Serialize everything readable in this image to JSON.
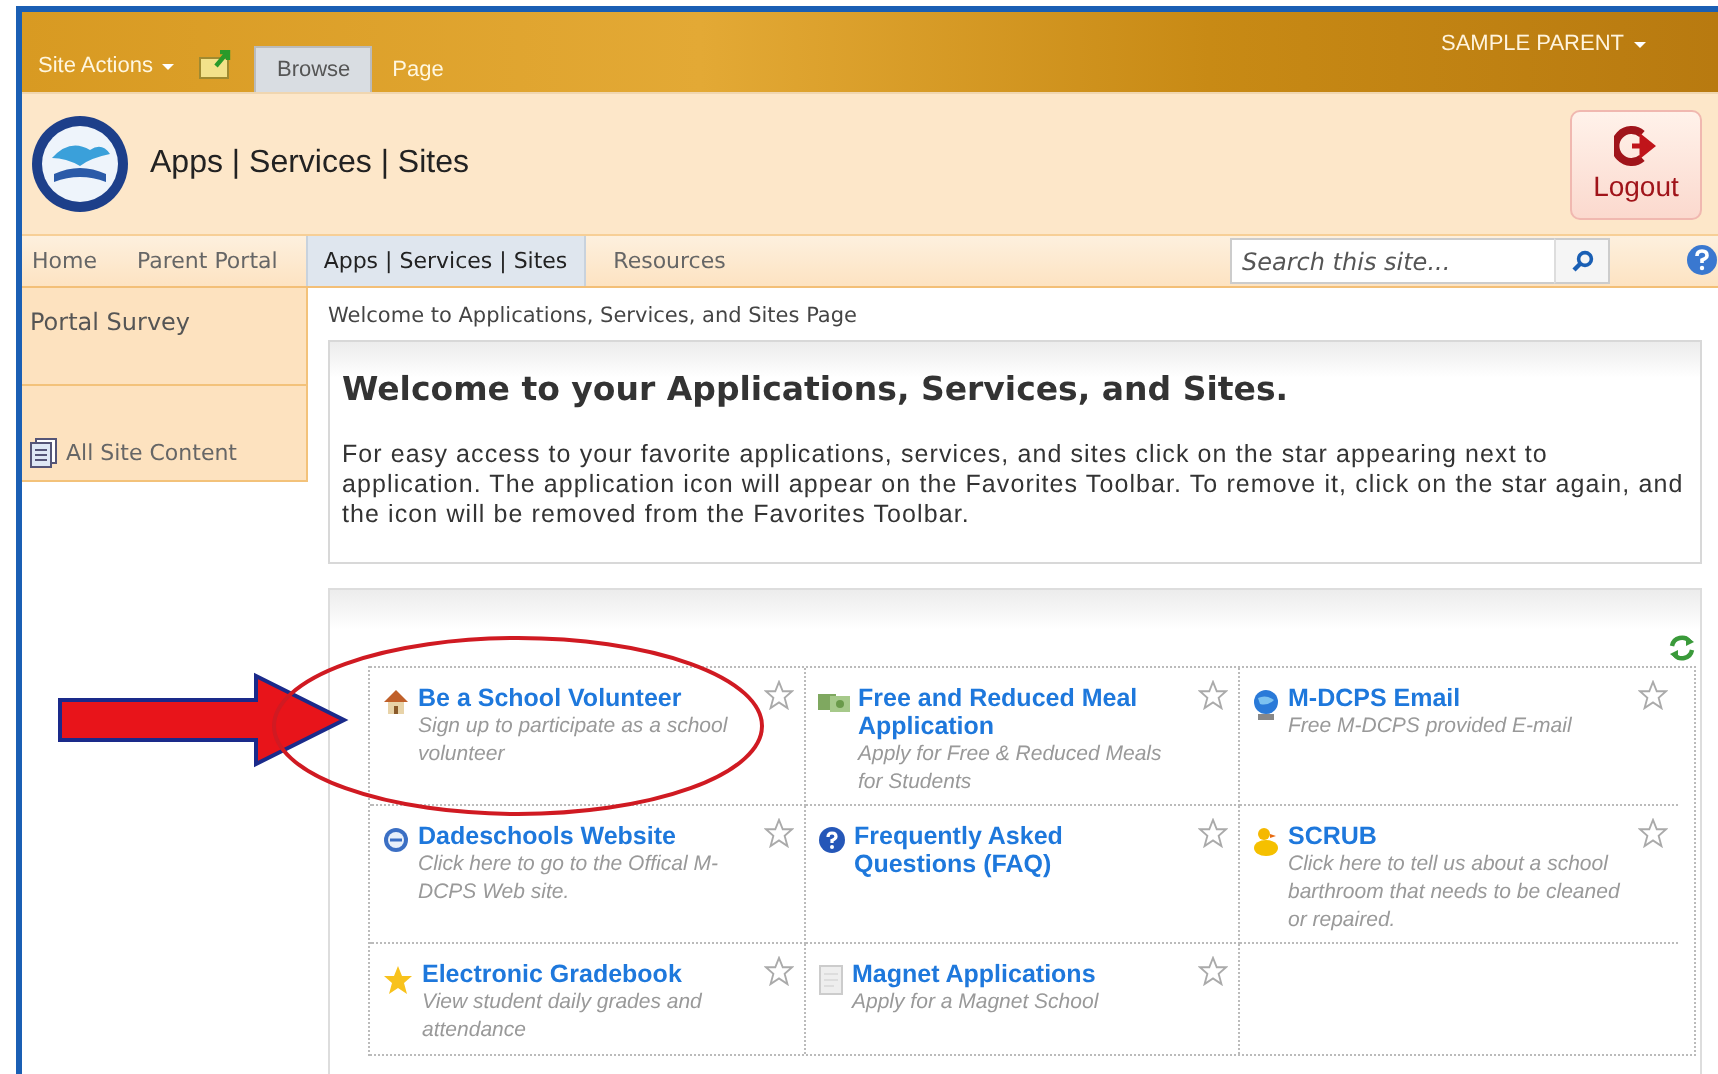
{
  "top_bar": {
    "site_actions": "Site Actions",
    "tabs": [
      {
        "label": "Browse",
        "selected": true
      },
      {
        "label": "Page",
        "selected": false
      }
    ],
    "user": "SAMPLE PARENT"
  },
  "header": {
    "title": "Apps | Services | Sites",
    "logout": "Logout"
  },
  "nav": {
    "items": [
      {
        "label": "Home",
        "selected": false
      },
      {
        "label": "Parent Portal",
        "selected": false
      },
      {
        "label": "Apps | Services | Sites",
        "selected": true
      },
      {
        "label": "Resources",
        "selected": false
      }
    ],
    "search": {
      "placeholder": "Search this site..."
    }
  },
  "sidebar": {
    "items": [
      {
        "label": "Portal Survey",
        "kind": "heading"
      },
      {
        "label": "All Site Content",
        "kind": "link"
      }
    ]
  },
  "breadcrumb": "Welcome to Applications, Services, and Sites Page",
  "welcome": {
    "heading": "Welcome to your Applications, Services, and Sites.",
    "text": "For easy access to your favorite applications, services, and sites click on the star appearing next to application. The application icon will appear on the Favorites Toolbar.  To remove it, click on the star again, and the icon will be removed from the Favorites Toolbar."
  },
  "apps": [
    {
      "title": "Be a School Volunteer",
      "description": "Sign up to participate as a school volunteer"
    },
    {
      "title": "Free and Reduced Meal Application",
      "description": "Apply for Free & Reduced Meals for Students"
    },
    {
      "title": "M-DCPS Email",
      "description": "Free M-DCPS provided E-mail"
    },
    {
      "title": "Dadeschools Website",
      "description": "Click here to go to the Offical M-DCPS Web site."
    },
    {
      "title": "Frequently Asked Questions (FAQ)"
    },
    {
      "title": "SCRUB",
      "description": "Click here to tell us about a school barthroom that needs to be cleaned or repaired."
    },
    {
      "title": "Electronic Gradebook",
      "description": "View student daily grades and attendance"
    },
    {
      "title": "Magnet Applications",
      "description": "Apply for a Magnet School"
    }
  ]
}
